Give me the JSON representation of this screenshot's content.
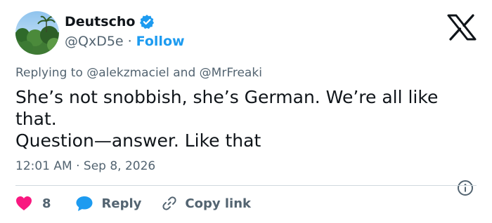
{
  "author": {
    "display_name": "Deutscho",
    "handle": "@QxD5e",
    "separator": "·",
    "follow_label": "Follow"
  },
  "reply_context": {
    "prefix": "Replying to ",
    "mention1": "@alekzmaciel",
    "joiner": " and ",
    "mention2": "@MrFreaki"
  },
  "tweet": {
    "text": "She’s not snobbish, she’s German. We’re all like\nthat.\nQuestion—answer. Like that",
    "timestamp": "12:01 AM · Sep 8, 2026"
  },
  "actions": {
    "like_count": "8",
    "reply_label": "Reply",
    "copy_label": "Copy link"
  },
  "colors": {
    "accent": "#1d9bf0",
    "like": "#f91880",
    "secondary_text": "#536471"
  }
}
